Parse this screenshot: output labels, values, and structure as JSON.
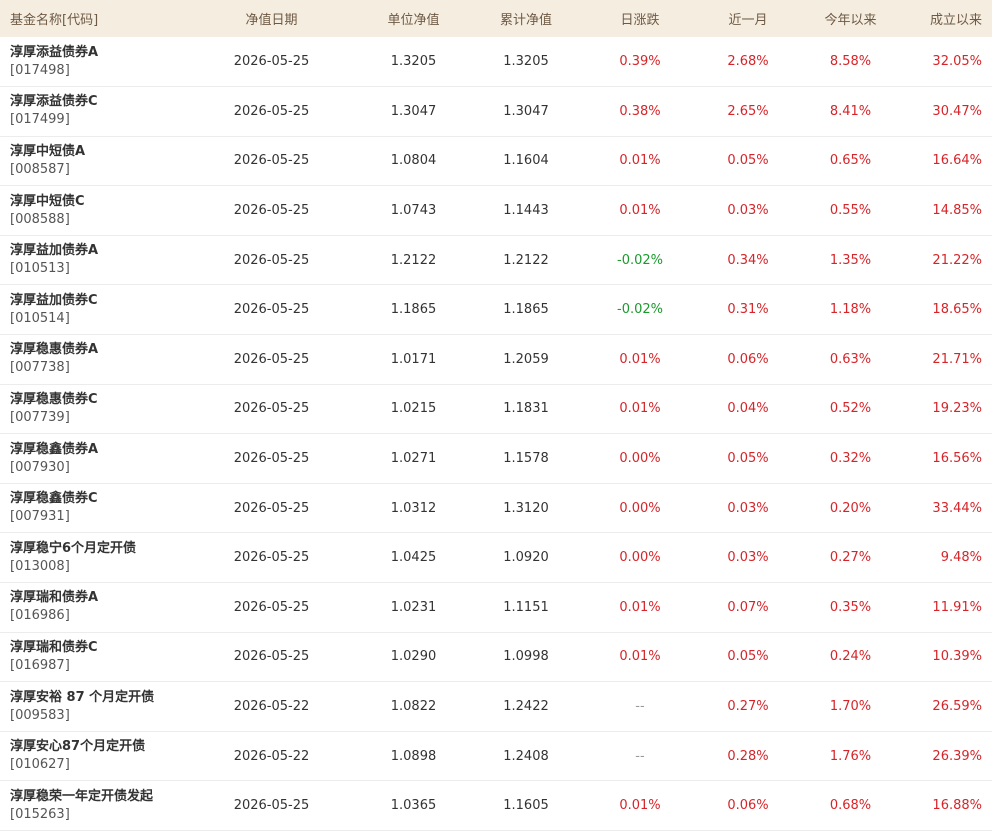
{
  "headers": {
    "name": "基金名称[代码]",
    "date": "净值日期",
    "unit_nav": "单位净值",
    "acc_nav": "累计净值",
    "day": "日涨跌",
    "month": "近一月",
    "ytd": "今年以来",
    "inception": "成立以来"
  },
  "colors": {
    "up": "#d6252a",
    "down": "#1b9a2e",
    "header_bg": "#f6ede1"
  },
  "rows": [
    {
      "name": "淳厚添益债券A",
      "code": "[017498]",
      "date": "2026-05-25",
      "unit_nav": "1.3205",
      "acc_nav": "1.3205",
      "day": "0.39%",
      "day_dir": "up",
      "month": "2.68%",
      "ytd": "8.58%",
      "inception": "32.05%"
    },
    {
      "name": "淳厚添益债券C",
      "code": "[017499]",
      "date": "2026-05-25",
      "unit_nav": "1.3047",
      "acc_nav": "1.3047",
      "day": "0.38%",
      "day_dir": "up",
      "month": "2.65%",
      "ytd": "8.41%",
      "inception": "30.47%"
    },
    {
      "name": "淳厚中短债A",
      "code": "[008587]",
      "date": "2026-05-25",
      "unit_nav": "1.0804",
      "acc_nav": "1.1604",
      "day": "0.01%",
      "day_dir": "up",
      "month": "0.05%",
      "ytd": "0.65%",
      "inception": "16.64%"
    },
    {
      "name": "淳厚中短债C",
      "code": "[008588]",
      "date": "2026-05-25",
      "unit_nav": "1.0743",
      "acc_nav": "1.1443",
      "day": "0.01%",
      "day_dir": "up",
      "month": "0.03%",
      "ytd": "0.55%",
      "inception": "14.85%"
    },
    {
      "name": "淳厚益加债券A",
      "code": "[010513]",
      "date": "2026-05-25",
      "unit_nav": "1.2122",
      "acc_nav": "1.2122",
      "day": "-0.02%",
      "day_dir": "down",
      "month": "0.34%",
      "ytd": "1.35%",
      "inception": "21.22%"
    },
    {
      "name": "淳厚益加债券C",
      "code": "[010514]",
      "date": "2026-05-25",
      "unit_nav": "1.1865",
      "acc_nav": "1.1865",
      "day": "-0.02%",
      "day_dir": "down",
      "month": "0.31%",
      "ytd": "1.18%",
      "inception": "18.65%"
    },
    {
      "name": "淳厚稳惠债券A",
      "code": "[007738]",
      "date": "2026-05-25",
      "unit_nav": "1.0171",
      "acc_nav": "1.2059",
      "day": "0.01%",
      "day_dir": "up",
      "month": "0.06%",
      "ytd": "0.63%",
      "inception": "21.71%"
    },
    {
      "name": "淳厚稳惠债券C",
      "code": "[007739]",
      "date": "2026-05-25",
      "unit_nav": "1.0215",
      "acc_nav": "1.1831",
      "day": "0.01%",
      "day_dir": "up",
      "month": "0.04%",
      "ytd": "0.52%",
      "inception": "19.23%"
    },
    {
      "name": "淳厚稳鑫债券A",
      "code": "[007930]",
      "date": "2026-05-25",
      "unit_nav": "1.0271",
      "acc_nav": "1.1578",
      "day": "0.00%",
      "day_dir": "up",
      "month": "0.05%",
      "ytd": "0.32%",
      "inception": "16.56%"
    },
    {
      "name": "淳厚稳鑫债券C",
      "code": "[007931]",
      "date": "2026-05-25",
      "unit_nav": "1.0312",
      "acc_nav": "1.3120",
      "day": "0.00%",
      "day_dir": "up",
      "month": "0.03%",
      "ytd": "0.20%",
      "inception": "33.44%"
    },
    {
      "name": "淳厚稳宁6个月定开债",
      "code": "[013008]",
      "date": "2026-05-25",
      "unit_nav": "1.0425",
      "acc_nav": "1.0920",
      "day": "0.00%",
      "day_dir": "up",
      "month": "0.03%",
      "ytd": "0.27%",
      "inception": "9.48%"
    },
    {
      "name": "淳厚瑞和债券A",
      "code": "[016986]",
      "date": "2026-05-25",
      "unit_nav": "1.0231",
      "acc_nav": "1.1151",
      "day": "0.01%",
      "day_dir": "up",
      "month": "0.07%",
      "ytd": "0.35%",
      "inception": "11.91%"
    },
    {
      "name": "淳厚瑞和债券C",
      "code": "[016987]",
      "date": "2026-05-25",
      "unit_nav": "1.0290",
      "acc_nav": "1.0998",
      "day": "0.01%",
      "day_dir": "up",
      "month": "0.05%",
      "ytd": "0.24%",
      "inception": "10.39%"
    },
    {
      "name": "淳厚安裕 87 个月定开债",
      "code": "[009583]",
      "date": "2026-05-22",
      "unit_nav": "1.0822",
      "acc_nav": "1.2422",
      "day": "--",
      "day_dir": "flat",
      "month": "0.27%",
      "ytd": "1.70%",
      "inception": "26.59%"
    },
    {
      "name": "淳厚安心87个月定开债",
      "code": "[010627]",
      "date": "2026-05-22",
      "unit_nav": "1.0898",
      "acc_nav": "1.2408",
      "day": "--",
      "day_dir": "flat",
      "month": "0.28%",
      "ytd": "1.76%",
      "inception": "26.39%"
    },
    {
      "name": "淳厚稳荣一年定开债发起",
      "code": "[015263]",
      "date": "2026-05-25",
      "unit_nav": "1.0365",
      "acc_nav": "1.1605",
      "day": "0.01%",
      "day_dir": "up",
      "month": "0.06%",
      "ytd": "0.68%",
      "inception": "16.88%"
    }
  ]
}
